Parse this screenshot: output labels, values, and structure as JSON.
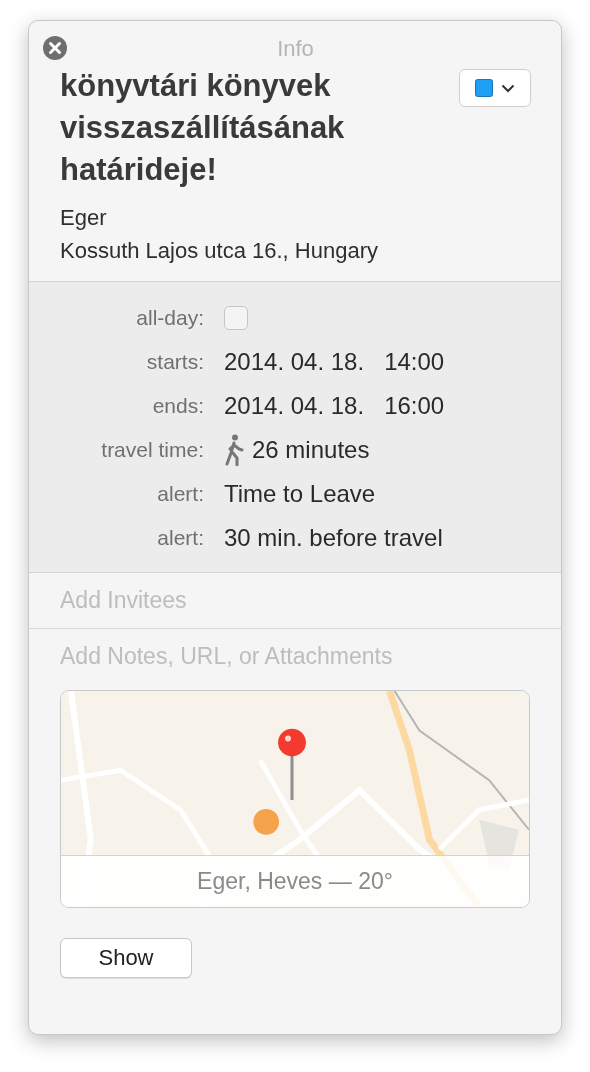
{
  "window": {
    "title": "Info"
  },
  "event": {
    "title": "könyvtári könyvek visszaszállításának határideje!",
    "location": "Eger",
    "address": "Kossuth Lajos utca 16., Hungary",
    "calendar": {
      "color": "#1ea1f5"
    }
  },
  "details": [
    {
      "kind": "checkbox",
      "label": "all-day:",
      "checked": false
    },
    {
      "kind": "datetime",
      "label": "starts:",
      "date": "2014. 04. 18.",
      "time": "14:00"
    },
    {
      "kind": "datetime",
      "label": "ends:",
      "date": "2014. 04. 18.",
      "time": "16:00"
    },
    {
      "kind": "travel",
      "label": "travel time:",
      "value": "26 minutes"
    },
    {
      "kind": "text",
      "label": "alert:",
      "value": "Time to Leave"
    },
    {
      "kind": "text",
      "label": "alert:",
      "value": "30 min. before travel"
    }
  ],
  "invitees": {
    "placeholder": "Add Invitees"
  },
  "notes": {
    "placeholder": "Add Notes, URL, or Attachments"
  },
  "map": {
    "kind": "picture",
    "caption": "Eger, Heves — 20°"
  },
  "buttons": [
    {
      "label": "Show"
    }
  ]
}
